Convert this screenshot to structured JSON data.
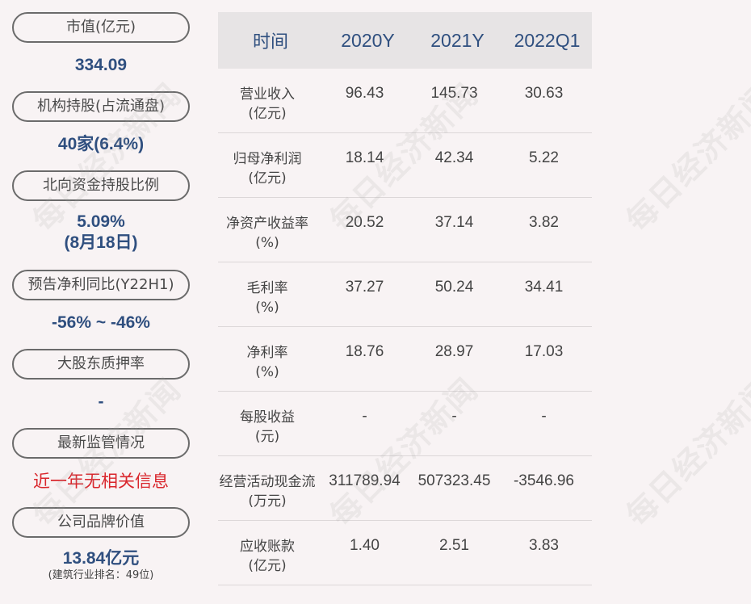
{
  "watermark": "每日经济新闻",
  "left_panel": {
    "market_cap": {
      "label": "市值(亿元)",
      "value": "334.09"
    },
    "institutional_holding": {
      "label": "机构持股(占流通盘)",
      "value": "40家(6.4%)"
    },
    "northbound_holding": {
      "label": "北向资金持股比例",
      "value": "5.09%",
      "value_date": "(8月18日)"
    },
    "profit_forecast": {
      "label": "预告净利同比(Y22H1)",
      "value": "-56% ~ -46%"
    },
    "pledge_ratio": {
      "label": "大股东质押率",
      "value": "-"
    },
    "regulation": {
      "label": "最新监管情况",
      "value": "近一年无相关信息",
      "value_color": "#d9262c"
    },
    "brand_value": {
      "label": "公司品牌价值",
      "value": "13.84亿元",
      "note": "(建筑行业排名：49位)"
    }
  },
  "table": {
    "headers": [
      "时间",
      "2020Y",
      "2021Y",
      "2022Q1"
    ],
    "rows": [
      {
        "label": "营业收入",
        "unit": "(亿元)",
        "values": [
          "96.43",
          "145.73",
          "30.63"
        ]
      },
      {
        "label": "归母净利润",
        "unit": "(亿元)",
        "values": [
          "18.14",
          "42.34",
          "5.22"
        ]
      },
      {
        "label": "净资产收益率",
        "unit": "(%)",
        "values": [
          "20.52",
          "37.14",
          "3.82"
        ]
      },
      {
        "label": "毛利率",
        "unit": "(%)",
        "values": [
          "37.27",
          "50.24",
          "34.41"
        ]
      },
      {
        "label": "净利率",
        "unit": "(%)",
        "values": [
          "18.76",
          "28.97",
          "17.03"
        ]
      },
      {
        "label": "每股收益",
        "unit": "(元)",
        "values": [
          "-",
          "-",
          "-"
        ]
      },
      {
        "label": "经营活动现金流",
        "unit": "(万元)",
        "values": [
          "311789.94",
          "507323.45",
          "-3546.96"
        ]
      },
      {
        "label": "应收账款",
        "unit": "(亿元)",
        "values": [
          "1.40",
          "2.51",
          "3.83"
        ]
      }
    ]
  },
  "colors": {
    "background": "#f8f3f4",
    "value_blue": "#2f4f7f",
    "alert_red": "#d9262c",
    "header_bg": "#e7e4e5"
  }
}
